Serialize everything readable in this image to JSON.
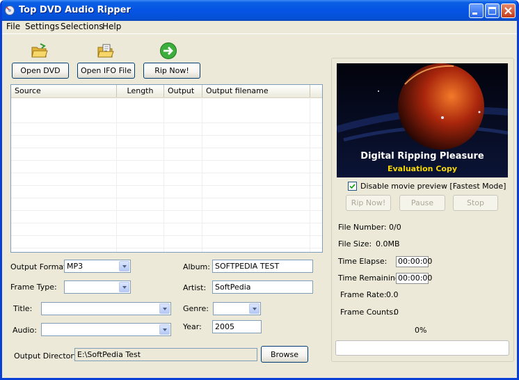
{
  "window": {
    "title": "Top DVD Audio Ripper"
  },
  "menu": {
    "items": [
      "File",
      "Settings",
      "Selections",
      "Help"
    ]
  },
  "toolbar": {
    "open_dvd": "Open DVD",
    "open_ifo": "Open IFO File",
    "rip_now": "Rip Now!",
    "icons": [
      "folder-open-icon",
      "folder-file-icon",
      "arrow-right-icon"
    ]
  },
  "track_list": {
    "columns": [
      "Source",
      "Length",
      "Output",
      "Output filename"
    ],
    "rows": []
  },
  "form": {
    "output_format_label": "Output Format:",
    "output_format_value": "MP3",
    "frame_type_label": "Frame Type:",
    "frame_type_value": "",
    "title_label": "Title:",
    "title_value": "",
    "audio_label": "Audio:",
    "audio_value": "",
    "album_label": "Album:",
    "album_value": "SOFTPEDIA TEST",
    "artist_label": "Artist:",
    "artist_value": "SoftPedia",
    "genre_label": "Genre:",
    "genre_value": "",
    "year_label": "Year:",
    "year_value": "2005",
    "output_dir_label": "Output Directory:",
    "output_dir_value": "E:\\SoftPedia Test",
    "browse": "Browse"
  },
  "preview": {
    "banner_title": "Digital Ripping Pleasure",
    "banner_subtitle": "Evaluation Copy",
    "disable_preview_label": "Disable movie preview [Fastest Mode]",
    "disable_preview_checked": true
  },
  "controls": {
    "rip_now": "Rip Now!",
    "pause": "Pause",
    "stop": "Stop"
  },
  "status": {
    "file_number_label": "File Number:",
    "file_number_value": "0/0",
    "file_size_label": "File Size:",
    "file_size_value": "0.0MB",
    "time_elapse_label": "Time Elapse:",
    "time_elapse_value": "00:00:00",
    "time_remaining_label": "Time Remaining:",
    "time_remaining_value": "00:00:00",
    "frame_rate_label": "Frame Rate:",
    "frame_rate_value": "0.0",
    "frame_counts_label": "Frame Counts:",
    "frame_counts_value": "0",
    "progress_text": "0%",
    "progress_fraction": 0
  },
  "colors": {
    "titlebar": "#0554e3",
    "accent_text": "#f7d800",
    "window_bg": "#ece9d8"
  }
}
